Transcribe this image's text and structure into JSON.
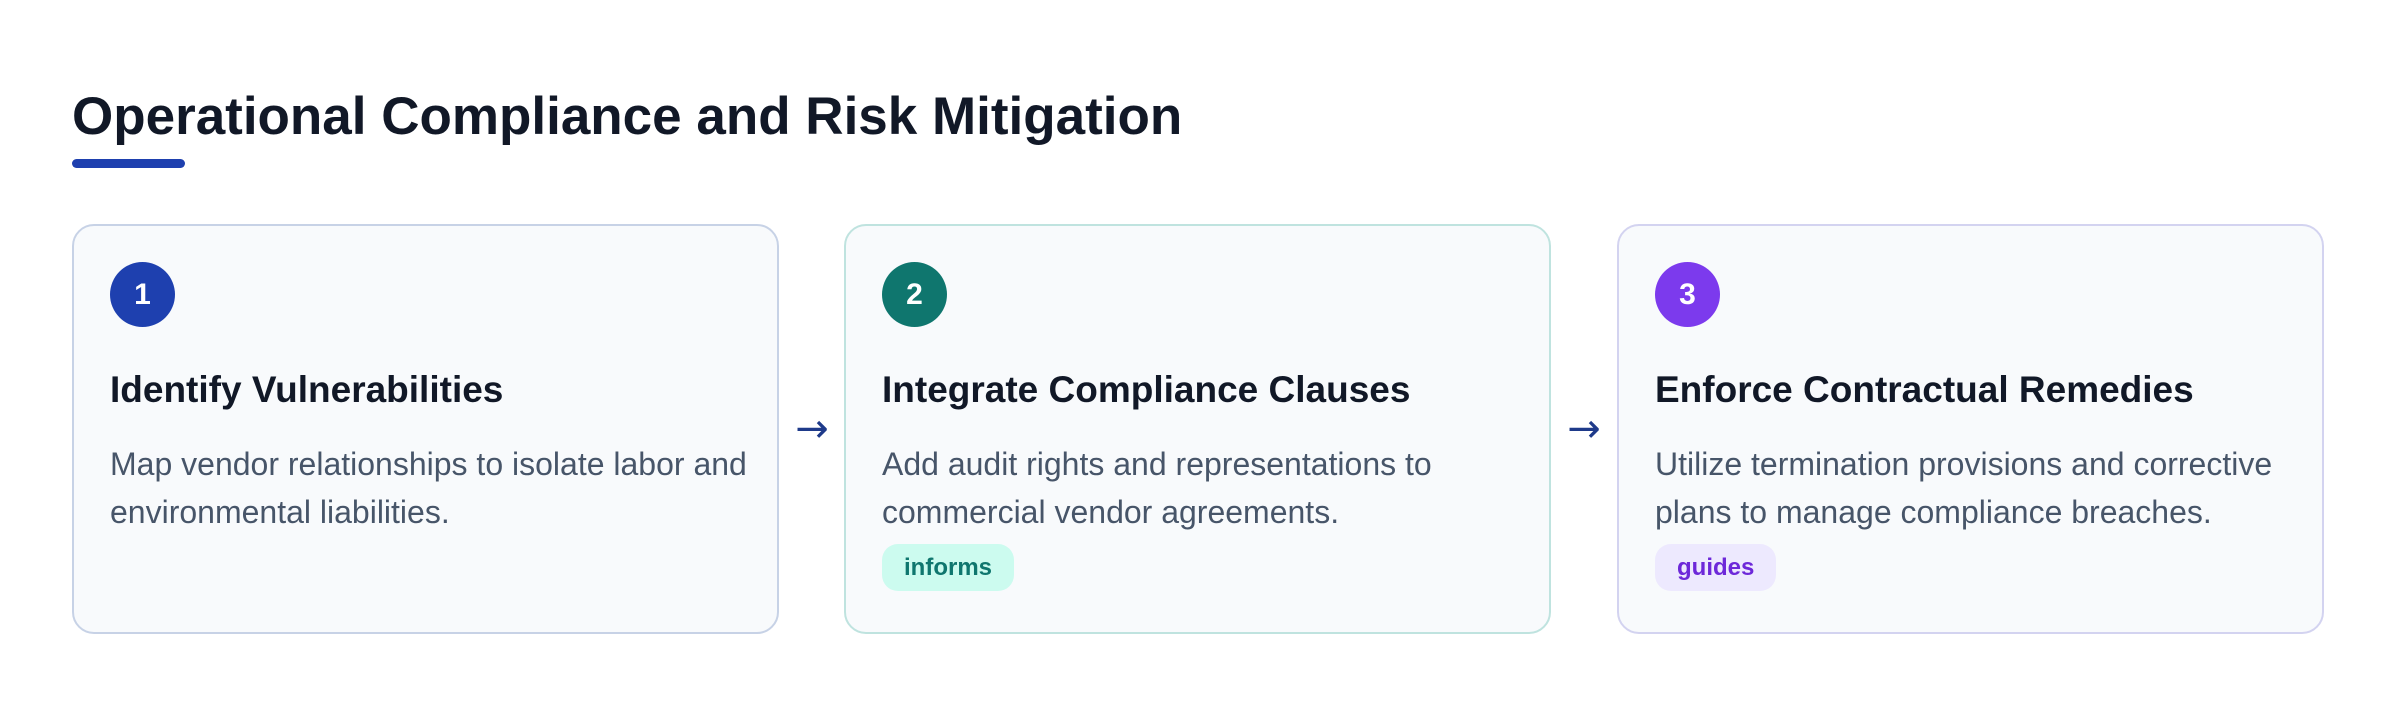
{
  "title": "Operational Compliance and Risk Mitigation",
  "colors": {
    "accent": "#1e40af",
    "teal": "#0f766e",
    "purple": "#7c3aed"
  },
  "arrow_glyph": "→",
  "steps": [
    {
      "number": "1",
      "title": "Identify Vulnerabilities",
      "description": "Map vendor relationships to isolate labor and environmental liabilities.",
      "color": "#1e40af"
    },
    {
      "number": "2",
      "title": "Integrate Compliance Clauses",
      "description": "Add audit rights and representations to commercial vendor agreements.",
      "tag": "informs",
      "color": "#0f766e"
    },
    {
      "number": "3",
      "title": "Enforce Contractual Remedies",
      "description": "Utilize termination provisions and corrective plans to manage compliance breaches.",
      "tag": "guides",
      "color": "#7c3aed"
    }
  ]
}
